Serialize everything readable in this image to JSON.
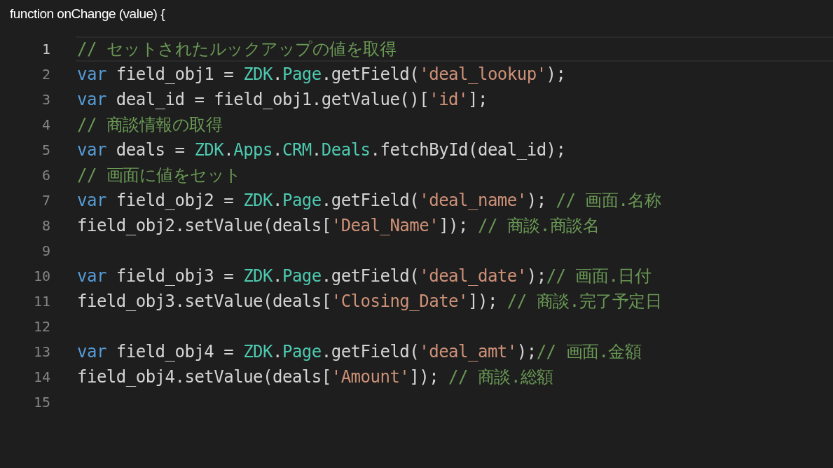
{
  "header": {
    "title": "function onChange (value) {"
  },
  "editor": {
    "lines": [
      {
        "number": "1",
        "selected": true,
        "tokens": [
          {
            "kind": "comment",
            "text": "// セットされたルックアップの値を取得"
          }
        ]
      },
      {
        "number": "2",
        "selected": false,
        "tokens": [
          {
            "kind": "keyword",
            "text": "var"
          },
          {
            "kind": "plain",
            "text": " field_obj1 = "
          },
          {
            "kind": "type",
            "text": "ZDK"
          },
          {
            "kind": "plain",
            "text": "."
          },
          {
            "kind": "type",
            "text": "Page"
          },
          {
            "kind": "plain",
            "text": ".getField("
          },
          {
            "kind": "string",
            "text": "'deal_lookup'"
          },
          {
            "kind": "plain",
            "text": ");"
          }
        ]
      },
      {
        "number": "3",
        "selected": false,
        "tokens": [
          {
            "kind": "keyword",
            "text": "var"
          },
          {
            "kind": "plain",
            "text": " deal_id = field_obj1.getValue()["
          },
          {
            "kind": "string",
            "text": "'id'"
          },
          {
            "kind": "plain",
            "text": "];"
          }
        ]
      },
      {
        "number": "4",
        "selected": false,
        "tokens": [
          {
            "kind": "comment",
            "text": "// 商談情報の取得"
          }
        ]
      },
      {
        "number": "5",
        "selected": false,
        "tokens": [
          {
            "kind": "keyword",
            "text": "var"
          },
          {
            "kind": "plain",
            "text": " deals = "
          },
          {
            "kind": "type",
            "text": "ZDK"
          },
          {
            "kind": "plain",
            "text": "."
          },
          {
            "kind": "type",
            "text": "Apps"
          },
          {
            "kind": "plain",
            "text": "."
          },
          {
            "kind": "type",
            "text": "CRM"
          },
          {
            "kind": "plain",
            "text": "."
          },
          {
            "kind": "type",
            "text": "Deals"
          },
          {
            "kind": "plain",
            "text": ".fetchById(deal_id);"
          }
        ]
      },
      {
        "number": "6",
        "selected": false,
        "tokens": [
          {
            "kind": "comment",
            "text": "// 画面に値をセット"
          }
        ]
      },
      {
        "number": "7",
        "selected": false,
        "tokens": [
          {
            "kind": "keyword",
            "text": "var"
          },
          {
            "kind": "plain",
            "text": " field_obj2 = "
          },
          {
            "kind": "type",
            "text": "ZDK"
          },
          {
            "kind": "plain",
            "text": "."
          },
          {
            "kind": "type",
            "text": "Page"
          },
          {
            "kind": "plain",
            "text": ".getField("
          },
          {
            "kind": "string",
            "text": "'deal_name'"
          },
          {
            "kind": "plain",
            "text": "); "
          },
          {
            "kind": "comment",
            "text": "// 画面.名称"
          }
        ]
      },
      {
        "number": "8",
        "selected": false,
        "tokens": [
          {
            "kind": "plain",
            "text": "field_obj2.setValue(deals["
          },
          {
            "kind": "string",
            "text": "'Deal_Name'"
          },
          {
            "kind": "plain",
            "text": "]); "
          },
          {
            "kind": "comment",
            "text": "// 商談.商談名"
          }
        ]
      },
      {
        "number": "9",
        "selected": false
      },
      {
        "number": "10",
        "selected": false,
        "tokens": [
          {
            "kind": "keyword",
            "text": "var"
          },
          {
            "kind": "plain",
            "text": " field_obj3 = "
          },
          {
            "kind": "type",
            "text": "ZDK"
          },
          {
            "kind": "plain",
            "text": "."
          },
          {
            "kind": "type",
            "text": "Page"
          },
          {
            "kind": "plain",
            "text": ".getField("
          },
          {
            "kind": "string",
            "text": "'deal_date'"
          },
          {
            "kind": "plain",
            "text": ");"
          },
          {
            "kind": "comment",
            "text": "// 画面.日付"
          }
        ]
      },
      {
        "number": "11",
        "selected": false,
        "tokens": [
          {
            "kind": "plain",
            "text": "field_obj3.setValue(deals["
          },
          {
            "kind": "string",
            "text": "'Closing_Date'"
          },
          {
            "kind": "plain",
            "text": "]); "
          },
          {
            "kind": "comment",
            "text": "// 商談.完了予定日"
          }
        ]
      },
      {
        "number": "12",
        "selected": false
      },
      {
        "number": "13",
        "selected": false,
        "tokens": [
          {
            "kind": "keyword",
            "text": "var"
          },
          {
            "kind": "plain",
            "text": " field_obj4 = "
          },
          {
            "kind": "type",
            "text": "ZDK"
          },
          {
            "kind": "plain",
            "text": "."
          },
          {
            "kind": "type",
            "text": "Page"
          },
          {
            "kind": "plain",
            "text": ".getField("
          },
          {
            "kind": "string",
            "text": "'deal_amt'"
          },
          {
            "kind": "plain",
            "text": ");"
          },
          {
            "kind": "comment",
            "text": "// 画面.金額"
          }
        ]
      },
      {
        "number": "14",
        "selected": false,
        "tokens": [
          {
            "kind": "plain",
            "text": "field_obj4.setValue(deals["
          },
          {
            "kind": "string",
            "text": "'Amount'"
          },
          {
            "kind": "plain",
            "text": "]); "
          },
          {
            "kind": "comment",
            "text": "// 商談.総額"
          }
        ]
      },
      {
        "number": "15",
        "selected": false
      }
    ]
  }
}
